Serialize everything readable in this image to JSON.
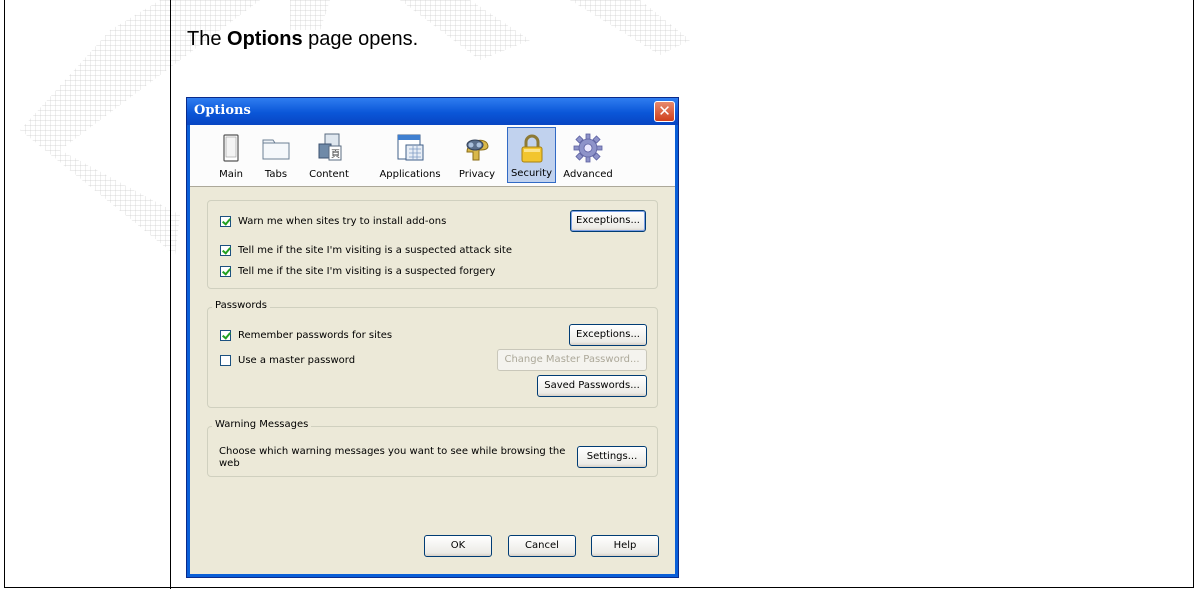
{
  "document": {
    "step_prefix": "The ",
    "step_bold": "Options",
    "step_suffix": " page opens."
  },
  "dialog": {
    "title": "Options",
    "close_glyph": "✕",
    "toolbar": [
      {
        "label": "Main",
        "icon": "main-icon"
      },
      {
        "label": "Tabs",
        "icon": "tabs-icon"
      },
      {
        "label": "Content",
        "icon": "content-icon"
      },
      {
        "label": "Applications",
        "icon": "applications-icon"
      },
      {
        "label": "Privacy",
        "icon": "privacy-icon"
      },
      {
        "label": "Security",
        "icon": "security-icon",
        "selected": true
      },
      {
        "label": "Advanced",
        "icon": "advanced-icon"
      }
    ],
    "security": {
      "warn_addons": "Warn me when sites try to install add-ons",
      "warn_addons_checked": true,
      "exceptions_label": "Exceptions...",
      "attack_site": "Tell me if the site I'm visiting is a suspected attack site",
      "attack_site_checked": true,
      "forgery": "Tell me if the site I'm visiting is a suspected forgery",
      "forgery_checked": true
    },
    "passwords": {
      "legend": "Passwords",
      "remember": "Remember passwords for sites",
      "remember_checked": true,
      "exceptions_label": "Exceptions...",
      "master": "Use a master password",
      "master_checked": false,
      "change_master_label": "Change Master Password...",
      "saved_label": "Saved Passwords..."
    },
    "warnings": {
      "legend": "Warning Messages",
      "description": "Choose which warning messages you want to see while browsing the web",
      "settings_label": "Settings..."
    },
    "footer": {
      "ok": "OK",
      "cancel": "Cancel",
      "help": "Help"
    }
  },
  "colors": {
    "titlebar": "#0a56d8",
    "dialog_face": "#ece9d8",
    "selected_tab": "#c1d2ee",
    "check": "#21a121"
  }
}
